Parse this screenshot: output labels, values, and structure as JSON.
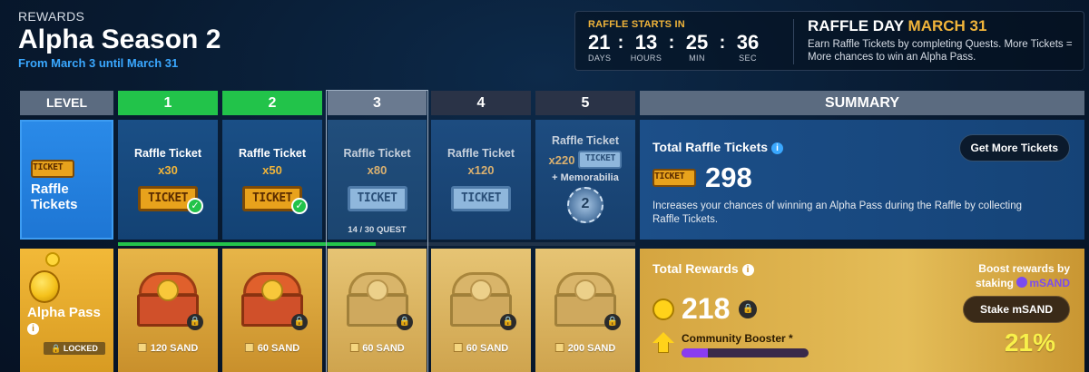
{
  "header": {
    "eyebrow": "REWARDS",
    "title": "Alpha Season 2",
    "dates": "From March 3 until March 31"
  },
  "timer": {
    "label": "RAFFLE STARTS IN",
    "days": "21",
    "days_unit": "DAYS",
    "hours": "13",
    "hours_unit": "HOURS",
    "min": "25",
    "min_unit": "MIN",
    "sec": "36",
    "sec_unit": "SEC"
  },
  "raffle_day": {
    "title_prefix": "RAFFLE DAY",
    "title_date": "MARCH 31",
    "desc": "Earn Raffle Tickets by completing Quests. More Tickets = More chances to win an Alpha Pass."
  },
  "columns": {
    "level": "LEVEL",
    "levels": [
      "1",
      "2",
      "3",
      "4",
      "5"
    ],
    "summary": "SUMMARY"
  },
  "tickets_row": {
    "label": "Raffle Tickets",
    "icon_text": "TICKET",
    "cells": [
      {
        "title": "Raffle Ticket",
        "amount": "x30",
        "status": "claimed"
      },
      {
        "title": "Raffle Ticket",
        "amount": "x50",
        "status": "claimed"
      },
      {
        "title": "Raffle Ticket",
        "amount": "x80",
        "status": "current",
        "quest": "14 / 30 QUEST"
      },
      {
        "title": "Raffle Ticket",
        "amount": "x120",
        "status": "upcoming"
      },
      {
        "title": "Raffle Ticket",
        "amount": "x220",
        "extra": "+ Memorabilia",
        "status": "upcoming"
      }
    ]
  },
  "progress": {
    "quest_done": 14,
    "quest_total": 30
  },
  "alpha_row": {
    "label": "Alpha Pass",
    "badge": "LOCKED",
    "cells": [
      {
        "reward": "120 SAND",
        "locked": true
      },
      {
        "reward": "60 SAND",
        "locked": true
      },
      {
        "reward": "60 SAND",
        "locked": true
      },
      {
        "reward": "60 SAND",
        "locked": true
      },
      {
        "reward": "200 SAND",
        "locked": true
      }
    ]
  },
  "summary_tickets": {
    "title": "Total Raffle Tickets",
    "count": "298",
    "button": "Get More Tickets",
    "desc": "Increases your chances of winning an Alpha Pass during the Raffle by collecting Raffle Tickets."
  },
  "summary_rewards": {
    "title": "Total Rewards",
    "count": "218",
    "boost_line1": "Boost rewards by",
    "boost_line2": "staking",
    "boost_token": "mSAND",
    "button": "Stake mSAND",
    "booster_label": "Community Booster *",
    "booster_fill": 0.21,
    "booster_pct": "21%"
  },
  "colors": {
    "accent_gold": "#f0b43a",
    "done_green": "#22c34a",
    "link_blue": "#3aa8ff",
    "booster_purple": "#8a3cf0",
    "pct_yellow": "#f8f04a"
  }
}
